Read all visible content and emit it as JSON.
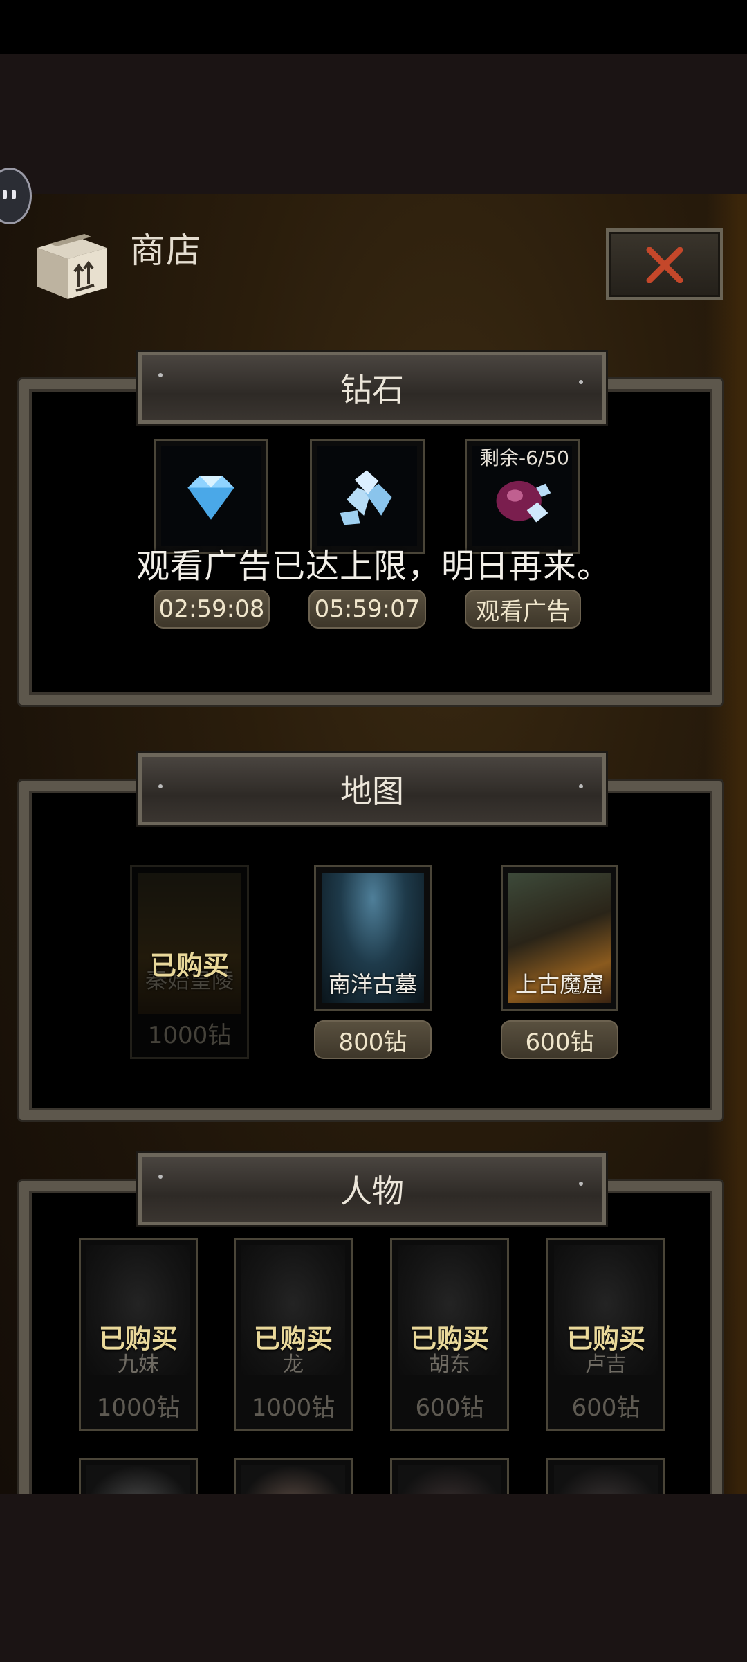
{
  "shop": {
    "title": "商店"
  },
  "sections": {
    "diamond": "钻石",
    "map": "地图",
    "character": "人物"
  },
  "diamond_items": [
    {
      "icon": "diamond-icon",
      "time": "02:59:08"
    },
    {
      "icon": "diamond-pile-icon",
      "time": "05:59:07"
    },
    {
      "icon": "gem-bag-icon",
      "remaining": "剩余-6/50",
      "action": "观看广告"
    }
  ],
  "toast": "观看广告已达上限，明日再来。",
  "maps": [
    {
      "name": "秦始皇陵",
      "price": "1000钻",
      "status": "已购买"
    },
    {
      "name": "南洋古墓",
      "price": "800钻"
    },
    {
      "name": "上古魔窟",
      "price": "600钻"
    }
  ],
  "characters": [
    {
      "name": "九妹",
      "price": "1000钻",
      "status": "已购买"
    },
    {
      "name": "龙",
      "price": "1000钻",
      "status": "已购买"
    },
    {
      "name": "胡东",
      "price": "600钻",
      "status": "已购买"
    },
    {
      "name": "卢吉",
      "price": "600钻",
      "status": "已购买"
    }
  ],
  "colors": {
    "accent_gold": "#e9d89a",
    "close_x": "#c4472a",
    "panel_frame": "#5d574c"
  }
}
